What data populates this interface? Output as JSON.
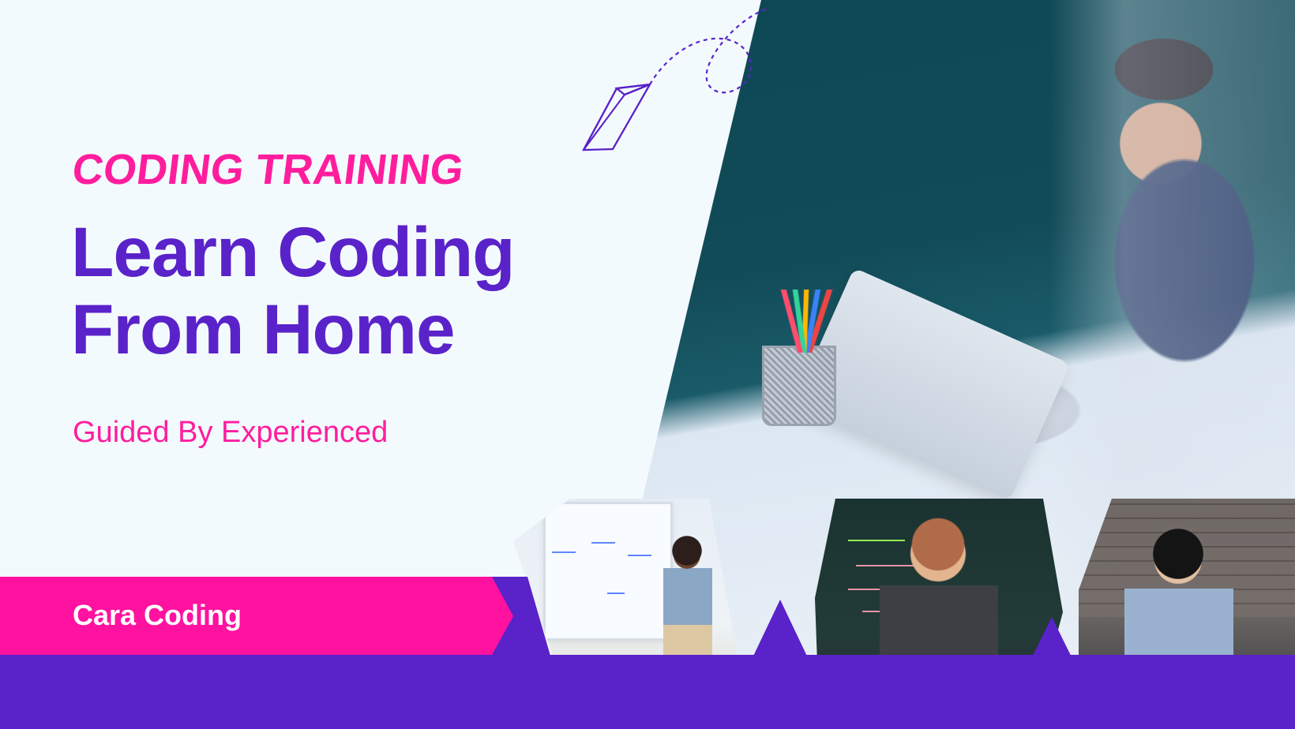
{
  "hero": {
    "eyebrow": "CODING TRAINING",
    "headline_line_1": "Learn Coding",
    "headline_line_2": "From Home",
    "subheadline": "Guided By Experienced"
  },
  "branding": {
    "label": "Cara Coding"
  },
  "colors": {
    "pink": "#ff12a0",
    "purple": "#5a22c9",
    "background": "#f3fafd"
  },
  "icons": {
    "paper_plane": "paper-plane-icon"
  }
}
